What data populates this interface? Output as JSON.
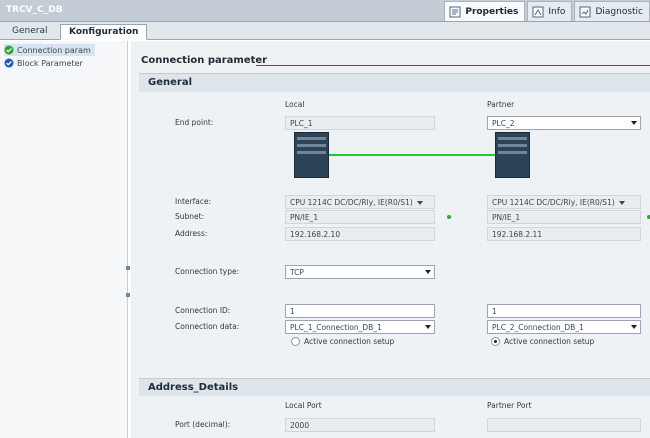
{
  "window": {
    "title": "TRCV_C_DB",
    "inspector_tabs": [
      {
        "label": "Properties",
        "icon": "properties-icon",
        "active": true
      },
      {
        "label": "Info",
        "icon": "info-icon",
        "active": false
      },
      {
        "label": "Diagnostic",
        "icon": "diagnostics-icon",
        "active": false
      }
    ]
  },
  "tabs": [
    {
      "label": "General"
    },
    {
      "label": "Konfiguration"
    }
  ],
  "sidebar": {
    "items": [
      {
        "label": "Connection param",
        "icon": "check-circle-icon",
        "status_color": "#2ea02e"
      },
      {
        "label": "Block Parameter",
        "icon": "check-circle-icon",
        "status_color": "#1f56c0"
      }
    ]
  },
  "main": {
    "section_title": "Connection parameter",
    "general": {
      "title": "General",
      "local_header": "Local",
      "partner_header": "Partner",
      "end_point": {
        "label": "End point:",
        "local": "PLC_1",
        "partner": "PLC_2"
      },
      "interface": {
        "label": "Interface:",
        "local": "CPU 1214C DC/DC/Rly, IE(R0/S1)",
        "partner": "CPU 1214C DC/DC/Rly, IE(R0/S1)"
      },
      "subnet": {
        "label": "Subnet:",
        "local": "PN/IE_1",
        "partner": "PN/IE_1"
      },
      "address": {
        "label": "Address:",
        "local": "192.168.2.10",
        "partner": "192.168.2.11"
      },
      "connection_type": {
        "label": "Connection type:",
        "value": "TCP"
      },
      "connection_id": {
        "label": "Connection ID:",
        "local": "1",
        "partner": "1"
      },
      "connection_data": {
        "label": "Connection data:",
        "local": "PLC_1_Connection_DB_1",
        "partner": "PLC_2_Connection_DB_1"
      },
      "active_setup": {
        "local_label": "Active connection setup",
        "local_checked": false,
        "partner_label": "Active connection setup",
        "partner_checked": true
      }
    },
    "address_details": {
      "title": "Address_Details",
      "local_port_header": "Local Port",
      "partner_port_header": "Partner Port",
      "port": {
        "label": "Port (decimal):",
        "local": "2000",
        "partner": ""
      }
    }
  },
  "colors": {
    "link_line": "#2fc42f",
    "subnet_dot": "#28b028",
    "device_body": "#2d4356"
  }
}
